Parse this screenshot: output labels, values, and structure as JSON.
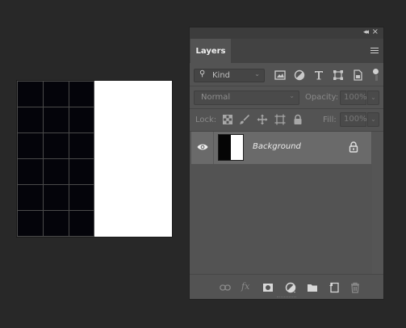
{
  "panel": {
    "title_bar": {
      "collapse_icon": "double-chevron-left",
      "close_icon": "close"
    },
    "tab_label": "Layers",
    "filter": {
      "kind_label": "Kind",
      "search_icon": "magnifier",
      "icons": [
        "pixel-filter-icon",
        "adjustment-filter-icon",
        "type-filter-icon",
        "shape-filter-icon",
        "smart-object-filter-icon"
      ]
    },
    "blend_mode": "Normal",
    "opacity_label": "Opacity:",
    "opacity_value": "100%",
    "lock_label": "Lock:",
    "fill_label": "Fill:",
    "fill_value": "100%",
    "layers": [
      {
        "name": "Background",
        "visible": true,
        "locked": true
      }
    ],
    "bottom_icons": [
      "link-layers",
      "fx",
      "add-mask",
      "adjustment",
      "group",
      "new-layer",
      "delete"
    ],
    "fx_label": "fx"
  },
  "colors": {
    "app_bg": "#282828",
    "panel_bg": "#535353",
    "selected_layer": "#6a6a6a",
    "canvas_white": "#ffffff",
    "canvas_dark": "#04040a"
  }
}
